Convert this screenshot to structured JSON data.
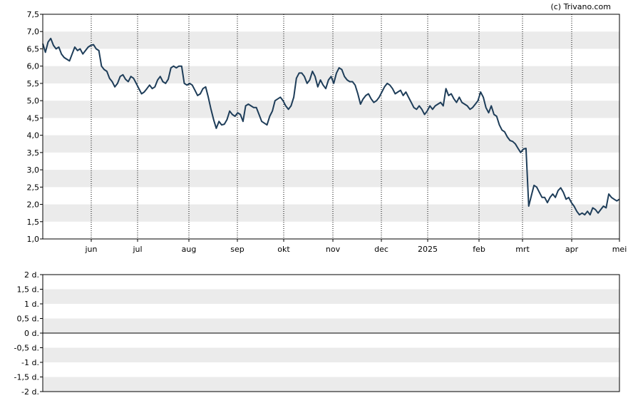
{
  "copyright": "(c) Trivano.com",
  "chart_data": [
    {
      "type": "line",
      "ylim": [
        1.0,
        7.5
      ],
      "y_ticks": [
        "7,5",
        "7,0",
        "6,5",
        "6,0",
        "5,5",
        "5,0",
        "4,5",
        "4,0",
        "3,5",
        "3,0",
        "2,5",
        "2,0",
        "1,5",
        "1,0"
      ],
      "x_ticks": [
        "jun",
        "jul",
        "aug",
        "sep",
        "okt",
        "nov",
        "dec",
        "2025",
        "feb",
        "mrt",
        "apr",
        "mei"
      ],
      "grid": "alternating horizontal bands, dotted vertical month lines",
      "colors": {
        "line": "#1e3d59",
        "band": "#ebebeb",
        "month_line": "#000000"
      },
      "series": [
        {
          "values": [
            6.65,
            6.4,
            6.7,
            6.8,
            6.6,
            6.5,
            6.55,
            6.35,
            6.25,
            6.2,
            6.15,
            6.35,
            6.55,
            6.45,
            6.5,
            6.35,
            6.45,
            6.55,
            6.6,
            6.62,
            6.5,
            6.45,
            6.0,
            5.9,
            5.85,
            5.65,
            5.55,
            5.4,
            5.5,
            5.7,
            5.75,
            5.62,
            5.55,
            5.7,
            5.65,
            5.5,
            5.35,
            5.2,
            5.25,
            5.35,
            5.45,
            5.35,
            5.4,
            5.6,
            5.7,
            5.55,
            5.5,
            5.62,
            5.95,
            6.0,
            5.95,
            6.0,
            6.0,
            5.5,
            5.45,
            5.5,
            5.45,
            5.3,
            5.15,
            5.2,
            5.35,
            5.4,
            5.1,
            4.75,
            4.45,
            4.2,
            4.4,
            4.3,
            4.32,
            4.45,
            4.7,
            4.6,
            4.55,
            4.65,
            4.6,
            4.4,
            4.85,
            4.9,
            4.85,
            4.8,
            4.8,
            4.6,
            4.4,
            4.35,
            4.3,
            4.55,
            4.7,
            5.0,
            5.05,
            5.1,
            5.0,
            4.85,
            4.75,
            4.85,
            5.1,
            5.65,
            5.8,
            5.8,
            5.7,
            5.5,
            5.6,
            5.85,
            5.7,
            5.4,
            5.6,
            5.45,
            5.35,
            5.6,
            5.7,
            5.5,
            5.8,
            5.95,
            5.9,
            5.7,
            5.6,
            5.55,
            5.55,
            5.45,
            5.2,
            4.9,
            5.05,
            5.15,
            5.2,
            5.05,
            4.95,
            5.0,
            5.1,
            5.25,
            5.4,
            5.5,
            5.45,
            5.35,
            5.2,
            5.25,
            5.3,
            5.15,
            5.25,
            5.1,
            4.95,
            4.8,
            4.75,
            4.85,
            4.75,
            4.6,
            4.7,
            4.85,
            4.75,
            4.85,
            4.9,
            4.95,
            4.85,
            5.35,
            5.15,
            5.2,
            5.05,
            4.95,
            5.1,
            4.95,
            4.9,
            4.85,
            4.75,
            4.8,
            4.9,
            5.0,
            5.25,
            5.1,
            4.8,
            4.65,
            4.85,
            4.6,
            4.55,
            4.3,
            4.15,
            4.1,
            3.95,
            3.85,
            3.82,
            3.75,
            3.62,
            3.5,
            3.6,
            3.62,
            1.95,
            2.25,
            2.55,
            2.5,
            2.35,
            2.2,
            2.2,
            2.05,
            2.2,
            2.3,
            2.2,
            2.4,
            2.48,
            2.35,
            2.15,
            2.2,
            2.05,
            1.95,
            1.8,
            1.7,
            1.75,
            1.7,
            1.8,
            1.7,
            1.9,
            1.85,
            1.75,
            1.85,
            1.95,
            1.9,
            2.3,
            2.2,
            2.15,
            2.1,
            2.15
          ]
        }
      ]
    },
    {
      "type": "line",
      "ylim": [
        -2,
        2
      ],
      "y_ticks": [
        "2 d.",
        "1,5 d.",
        "1 d.",
        "0,5 d.",
        "0 d.",
        "-0,5 d.",
        "-1 d.",
        "-1,5 d.",
        "-2 d."
      ],
      "colors": {
        "zero_line": "#000000",
        "band": "#ebebeb"
      },
      "series": []
    }
  ]
}
